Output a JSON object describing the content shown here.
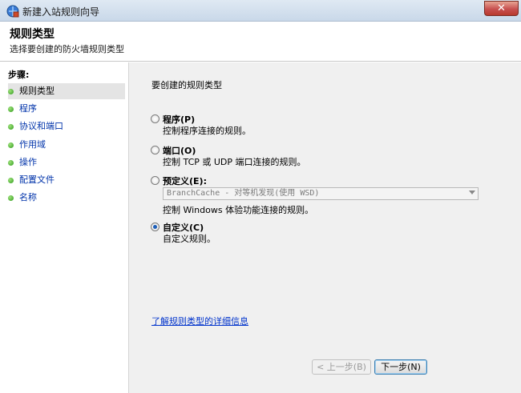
{
  "window": {
    "title": "新建入站规则向导",
    "close_label": "✕"
  },
  "header": {
    "title": "规则类型",
    "subtitle": "选择要创建的防火墙规则类型"
  },
  "steps": {
    "label": "步骤:",
    "items": [
      {
        "label": "规则类型",
        "active": true
      },
      {
        "label": "程序"
      },
      {
        "label": "协议和端口"
      },
      {
        "label": "作用域"
      },
      {
        "label": "操作"
      },
      {
        "label": "配置文件"
      },
      {
        "label": "名称"
      }
    ]
  },
  "main": {
    "section_title": "要创建的规则类型",
    "options": [
      {
        "label": "程序(P)",
        "description": "控制程序连接的规则。",
        "selected": false
      },
      {
        "label": "端口(O)",
        "description": "控制 TCP 或 UDP 端口连接的规则。",
        "selected": false
      },
      {
        "label": "预定义(E):",
        "description": "控制 Windows 体验功能连接的规则。",
        "selected": false
      },
      {
        "label": "自定义(C)",
        "description": "自定义规则。",
        "selected": true
      }
    ],
    "predefined_select": {
      "value": "BranchCache - 对等机发现(使用 WSD)"
    },
    "learn_more": "了解规则类型的详细信息"
  },
  "buttons": {
    "back": "< 上一步(B)",
    "next": "下一步(N)"
  },
  "colors": {
    "link": "#0033cc",
    "step_dot": "#2f9a1c",
    "titlebar": "#c9d8e9"
  }
}
